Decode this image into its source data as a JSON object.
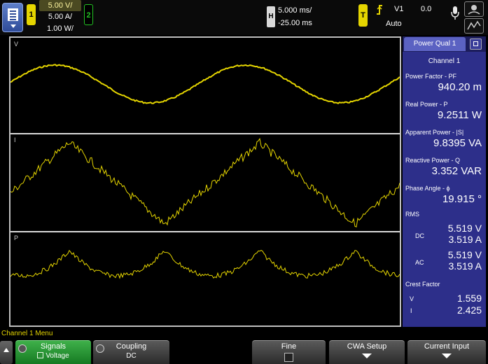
{
  "topbar": {
    "menu_icon": "menu-icon",
    "ch1_label": "1",
    "ch2_label": "2",
    "scale_v": "5.00 V/",
    "scale_a": "5.00 A/",
    "scale_w": "1.00 W/",
    "horiz_label": "H",
    "time_per_div": "5.000 ms/",
    "delay": "-25.00 ms",
    "trig_label": "T",
    "trig_source": "V1",
    "trig_level": "0.0",
    "trig_mode": "Auto",
    "colors": {
      "ch1": "#e5d500",
      "ch2": "#23c223"
    }
  },
  "waveforms": {
    "v_label": "V",
    "i_label": "I",
    "p_label": "P",
    "trace_color": "#e5d500"
  },
  "panel": {
    "tab": "Power Qual 1",
    "channel": "Channel 1",
    "pf_label": "Power Factor - PF",
    "pf_value": "940.20 m",
    "p_label": "Real Power - P",
    "p_value": "9.2511 W",
    "s_label": "Apparent Power - |S|",
    "s_value": "9.8395 VA",
    "q_label": "Reactive Power - Q",
    "q_value": "3.352 VAR",
    "phase_label": "Phase Angle - ϕ",
    "phase_value": "19.915 °",
    "rms_label": "RMS",
    "dc_label": "DC",
    "dc_v": "5.519 V",
    "dc_a": "3.519 A",
    "ac_label": "AC",
    "ac_v": "5.519 V",
    "ac_a": "3.519 A",
    "crest_label": "Crest Factor",
    "crest_v_label": "V",
    "crest_v": "1.559",
    "crest_i_label": "I",
    "crest_i": "2.425",
    "bg_color": "#2d2f8a"
  },
  "menu": {
    "title": "Channel 1 Menu",
    "signals_label": "Signals",
    "signals_value": "Voltage",
    "coupling_label": "Coupling",
    "coupling_value": "DC",
    "fine_label": "Fine",
    "cwa_label": "CWA Setup",
    "current_label": "Current Input"
  }
}
